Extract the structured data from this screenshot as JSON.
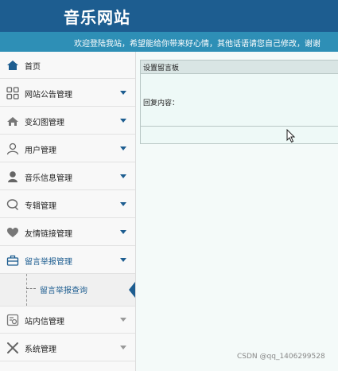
{
  "header": {
    "site_title": "音乐网站",
    "marquee": "欢迎登陆我站，希望能给你带来好心情，其他话语请您自己修改，谢谢"
  },
  "sidebar": {
    "items": [
      {
        "label": "首页",
        "icon": "home-icon"
      },
      {
        "label": "网站公告管理",
        "icon": "grid-icon"
      },
      {
        "label": "变幻图管理",
        "icon": "house-icon"
      },
      {
        "label": "用户管理",
        "icon": "user-outline-icon"
      },
      {
        "label": "音乐信息管理",
        "icon": "user-solid-icon"
      },
      {
        "label": "专辑管理",
        "icon": "chat-bubble-icon"
      },
      {
        "label": "友情链接管理",
        "icon": "heart-icon"
      },
      {
        "label": "留言举报管理",
        "icon": "briefcase-icon"
      },
      {
        "label": "站内信管理",
        "icon": "message-icon"
      },
      {
        "label": "系统管理",
        "icon": "tools-icon"
      }
    ],
    "submenu_label": "留言举报查询"
  },
  "panel": {
    "title": "设置留言板",
    "reply_label": "回复内容："
  },
  "watermark": "CSDN @qq_1406299528",
  "colors": {
    "header": "#1d5d90",
    "marquee": "#2e8fb6",
    "panel_bg": "#eef9f7"
  }
}
